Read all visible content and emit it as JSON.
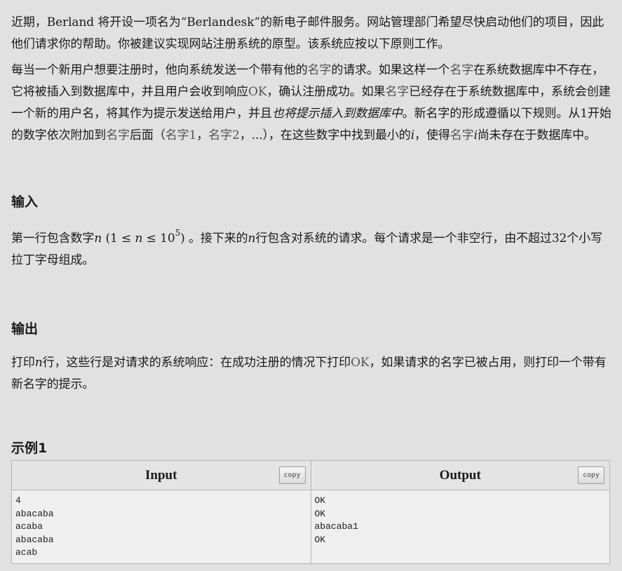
{
  "statement": {
    "p1": {
      "a": "近期，",
      "b": "Berland",
      "c": " 将开设一项名为",
      "d": "“Berlandesk”",
      "e": "的新电子邮件服务。网站管理部门希望尽快启动他们的项目，因此他们请求你的帮助。你被建议实现网站注册系统的原型。该系统应按以下原则工作。"
    },
    "p2": {
      "t1": "每当一个新用户想要注册时，他向系统发送一个带有他的",
      "name1": "名字",
      "t2": "的请求。如果这样一个",
      "name2": "名字",
      "t3": "在系统数据库中不存在，它将被插入到数据库中，并且用户会收到响应",
      "ok1": "OK",
      "t4": "，确认注册成功。如果",
      "name3": "名字",
      "t5": "已经存在于系统数据库中，系统会创建一个新的用户名，将其作为提示发送给用户，并且",
      "t6": "也将提示插入到数据库中",
      "t7": "。新名字的形成遵循以下规则。从",
      "one": "1",
      "t8": "开始的数字依次附加到",
      "name4": "名字",
      "t9": "后面（",
      "name5": "名字1",
      "t10": "，",
      "name6": "名字2",
      "t11": "，...），在这些数字中找到最小的",
      "i1": "i",
      "t12": "，使得",
      "name7": "名字",
      "i2": "i",
      "t13": "尚未存在于数据库中。"
    }
  },
  "input_section": {
    "heading": "输入",
    "t1": "第一行包含数字",
    "n1": "n",
    "t2": " (",
    "one": "1",
    "le1": " ≤ ",
    "n2": "n",
    "le2": " ≤ ",
    "base": "10",
    "exp": "5",
    "t3": ")",
    "t4": " 。接下来的",
    "n3": "n",
    "t5": "行包含对系统的请求。每个请求是一个非空行，由不超过",
    "num32": "32",
    "t6": "个小写拉丁字母组成。"
  },
  "output_section": {
    "heading": "输出",
    "t1": "打印",
    "n1": "n",
    "t2": "行，这些行是对请求的系统响应：在成功注册的情况下打印",
    "ok": "OK",
    "t3": "，如果请求的名字已被占用，则打印一个带有新名字的提示。"
  },
  "example": {
    "heading": "示例1",
    "input_label": "Input",
    "output_label": "Output",
    "copy_label": "copy",
    "input_lines": [
      "4",
      "abacaba",
      "acaba",
      "abacaba",
      "acab"
    ],
    "output_lines": [
      "OK",
      "OK",
      "abacaba1",
      "OK"
    ]
  }
}
